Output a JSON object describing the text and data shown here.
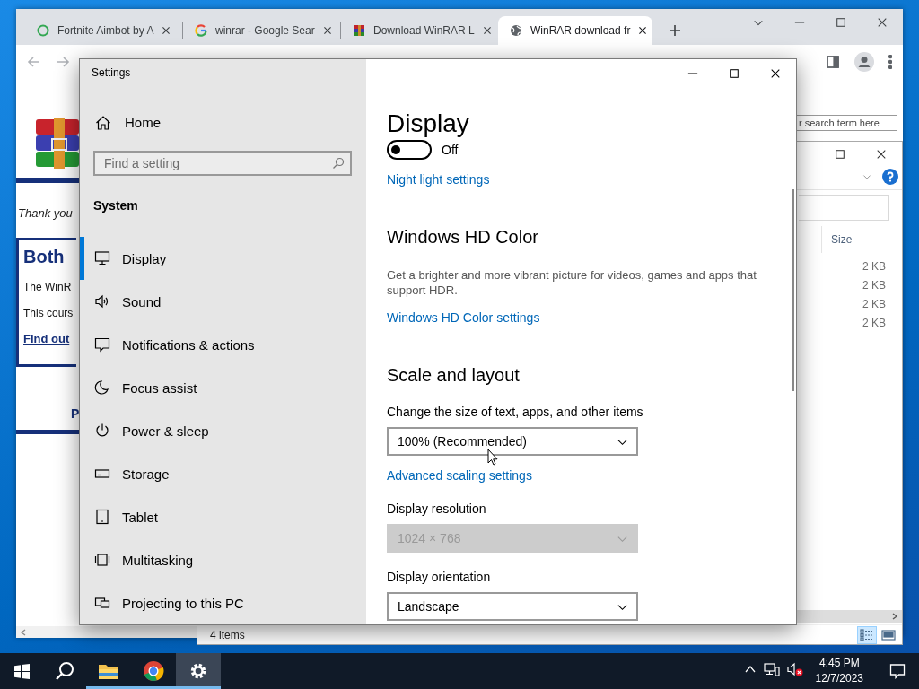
{
  "browser": {
    "tabs": [
      {
        "title": "Fortnite Aimbot by A",
        "selected": false
      },
      {
        "title": "winrar - Google Sear",
        "selected": false
      },
      {
        "title": "Download WinRAR L",
        "selected": false
      },
      {
        "title": "WinRAR download fr",
        "selected": true
      }
    ],
    "page": {
      "tagline": "Thank you",
      "box_title": "Both",
      "box_lines": [
        "The WinR",
        "This cours"
      ],
      "box_link": "Find out",
      "footer_text": "P",
      "search_placeholder": "r search term here"
    }
  },
  "explorer": {
    "columns": [
      "Size"
    ],
    "rows": [
      {
        "size": "2 KB"
      },
      {
        "size": "2 KB"
      },
      {
        "size": "2 KB"
      },
      {
        "size": "2 KB"
      }
    ],
    "status": "4 items",
    "view_buttons": [
      {
        "selected": true
      },
      {
        "selected": false
      }
    ]
  },
  "settings": {
    "title": "Settings",
    "home": "Home",
    "search_placeholder": "Find a setting",
    "section": "System",
    "nav": [
      {
        "label": "Display",
        "selected": true
      },
      {
        "label": "Sound",
        "selected": false
      },
      {
        "label": "Notifications & actions",
        "selected": false
      },
      {
        "label": "Focus assist",
        "selected": false
      },
      {
        "label": "Power & sleep",
        "selected": false
      },
      {
        "label": "Storage",
        "selected": false
      },
      {
        "label": "Tablet",
        "selected": false
      },
      {
        "label": "Multitasking",
        "selected": false
      },
      {
        "label": "Projecting to this PC",
        "selected": false
      }
    ],
    "content": [
      {
        "kind": "title",
        "text": "Display"
      },
      {
        "kind": "toggle",
        "on": false,
        "text": "Off"
      },
      {
        "kind": "link",
        "text": "Night light settings"
      },
      {
        "kind": "heading",
        "text": "Windows HD Color"
      },
      {
        "kind": "text",
        "text": "Get a brighter and more vibrant picture for videos, games and apps that support HDR."
      },
      {
        "kind": "link",
        "text": "Windows HD Color settings"
      },
      {
        "kind": "heading",
        "text": "Scale and layout"
      },
      {
        "kind": "label",
        "text": "Change the size of text, apps, and other items"
      },
      {
        "kind": "dropdown",
        "value": "100% (Recommended)",
        "disabled": false
      },
      {
        "kind": "link",
        "text": "Advanced scaling settings"
      },
      {
        "kind": "label",
        "text": "Display resolution"
      },
      {
        "kind": "dropdown",
        "value": "1024 × 768",
        "disabled": true
      },
      {
        "kind": "label",
        "text": "Display orientation"
      },
      {
        "kind": "dropdown",
        "value": "Landscape",
        "disabled": false
      }
    ]
  },
  "taskbar": {
    "apps": [
      {
        "running": true,
        "selected": false
      },
      {
        "running": true,
        "selected": false
      },
      {
        "running": true,
        "selected": true
      }
    ],
    "time": "4:45 PM",
    "date": "12/7/2023"
  }
}
